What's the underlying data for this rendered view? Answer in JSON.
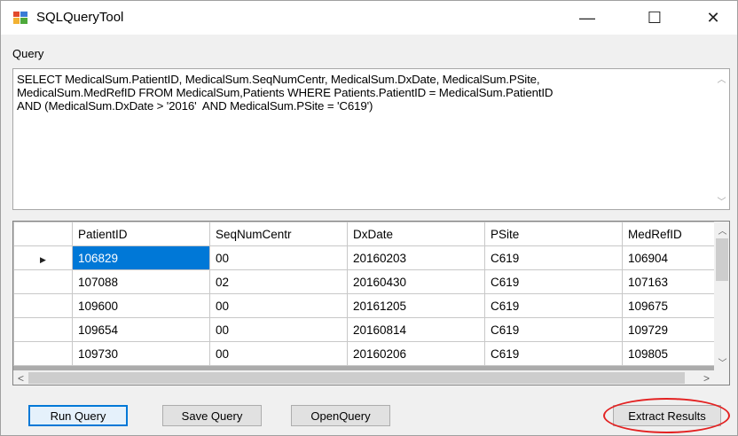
{
  "window": {
    "title": "SQLQueryTool",
    "minimize_glyph": "—",
    "maximize_glyph": "☐",
    "close_glyph": "✕"
  },
  "query": {
    "label": "Query",
    "text": "SELECT MedicalSum.PatientID, MedicalSum.SeqNumCentr, MedicalSum.DxDate, MedicalSum.PSite,\nMedicalSum.MedRefID FROM MedicalSum,Patients WHERE Patients.PatientID = MedicalSum.PatientID\nAND (MedicalSum.DxDate > '2016'  AND MedicalSum.PSite = 'C619')"
  },
  "grid": {
    "columns": [
      "PatientID",
      "SeqNumCentr",
      "DxDate",
      "PSite",
      "MedRefID"
    ],
    "rows": [
      [
        "106829",
        "00",
        "20160203",
        "C619",
        "106904"
      ],
      [
        "107088",
        "02",
        "20160430",
        "C619",
        "107163"
      ],
      [
        "109600",
        "00",
        "20161205",
        "C619",
        "109675"
      ],
      [
        "109654",
        "00",
        "20160814",
        "C619",
        "109729"
      ],
      [
        "109730",
        "00",
        "20160206",
        "C619",
        "109805"
      ]
    ],
    "current_row_marker": "▶"
  },
  "buttons": {
    "run": "Run Query",
    "save": "Save Query",
    "open": "OpenQuery",
    "extract": "Extract Results"
  },
  "colors": {
    "selection": "#0078d7",
    "annotation_circle": "#e32222"
  }
}
